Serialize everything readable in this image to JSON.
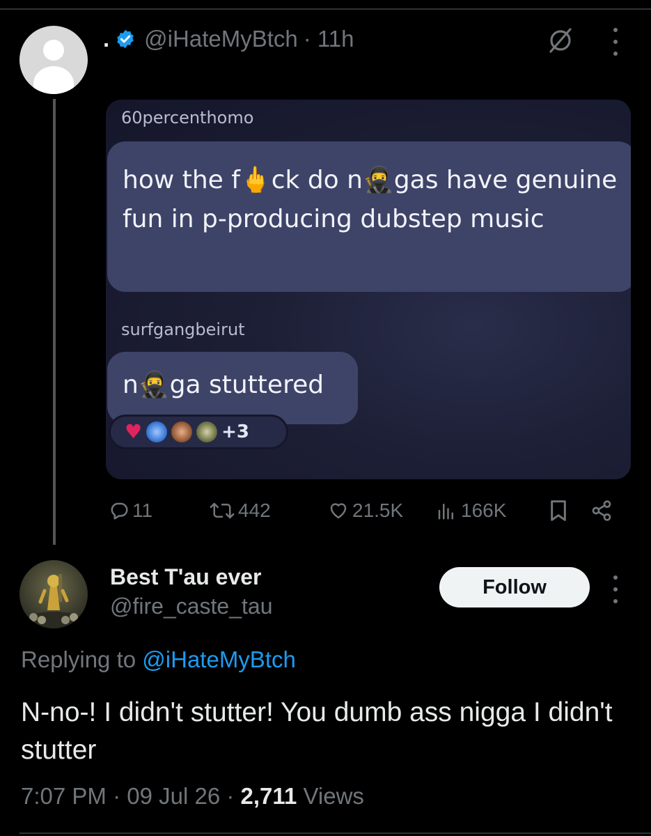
{
  "parent_tweet": {
    "display_name": ".",
    "handle": "@iHateMyBtch",
    "time": "· 11h",
    "image": {
      "user1": "60percenthomo",
      "message1": "how the f🖕ck do n🥷gas have genuine fun in p-producing dubstep music",
      "user2": "surfgangbeirut",
      "message2": "n🥷ga stuttered",
      "reaction_extra": "+3"
    },
    "stats": {
      "replies": "11",
      "reposts": "442",
      "likes": "21.5K",
      "views": "166K"
    }
  },
  "reply_tweet": {
    "display_name": "Best T'au ever",
    "handle": "@fire_caste_tau",
    "follow_label": "Follow",
    "replying_to_label": "Replying to",
    "replying_to_handle": "@iHateMyBtch",
    "text": "N-no-! I didn't stutter! You dumb ass nigga I didn't stutter",
    "time": "7:07 PM",
    "date": "09 Jul 26",
    "views_count": "2,711",
    "views_label": "Views"
  },
  "colors": {
    "background": "#000000",
    "secondary_text": "#71767b",
    "accent": "#1d9bf0",
    "verified": "#1d9bf0",
    "bubble": "#3e4468"
  }
}
